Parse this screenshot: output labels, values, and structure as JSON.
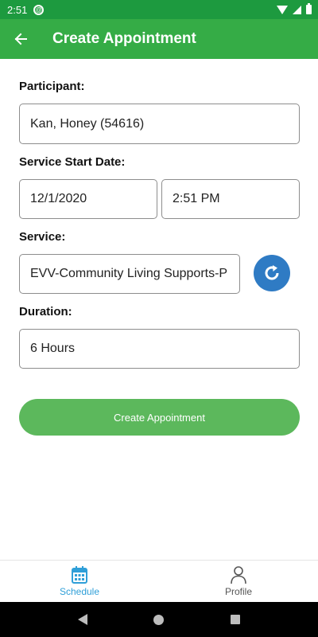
{
  "status_bar": {
    "time": "2:51"
  },
  "app_bar": {
    "title": "Create Appointment"
  },
  "form": {
    "participant_label": "Participant:",
    "participant_value": "Kan, Honey (54616)",
    "start_date_label": "Service Start Date:",
    "start_date_value": "12/1/2020",
    "start_time_value": "2:51 PM",
    "service_label": "Service:",
    "service_value": "EVV-Community Living Supports-P",
    "duration_label": "Duration:",
    "duration_value": "6 Hours",
    "submit_label": "Create Appointment"
  },
  "tabs": [
    {
      "label": "Schedule",
      "icon": "calendar-icon",
      "active": true
    },
    {
      "label": "Profile",
      "icon": "person-icon",
      "active": false
    }
  ],
  "colors": {
    "status_bar": "#1d9a3f",
    "app_bar": "#35ac46",
    "primary_button": "#5cb85c",
    "refresh_button": "#2f7bc4",
    "active_tab": "#2f9fd8"
  }
}
